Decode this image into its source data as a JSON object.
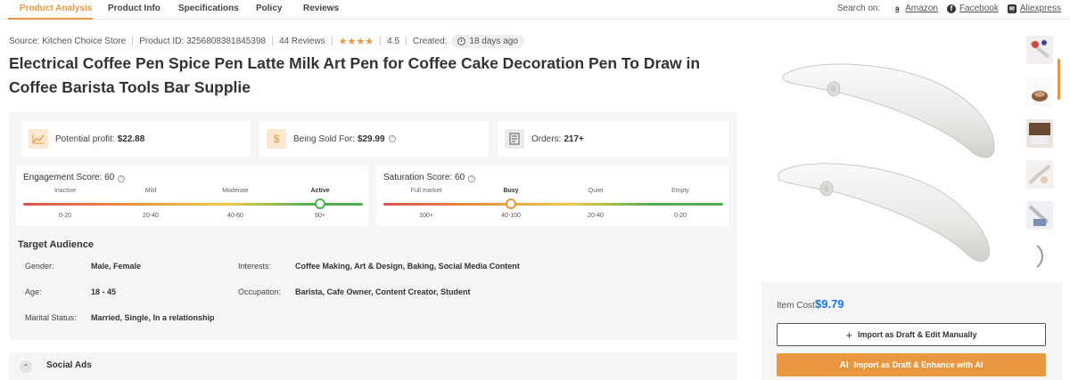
{
  "tabs": [
    {
      "label": "Product Analysis",
      "active": true
    },
    {
      "label": "Product Info",
      "active": false
    },
    {
      "label": "Specifications",
      "active": false
    },
    {
      "label": "Policy",
      "active": false
    },
    {
      "label": "Reviews",
      "active": false
    }
  ],
  "search_on": {
    "label": "Search on:",
    "links": [
      {
        "label": "Amazon",
        "icon": "amazon-icon"
      },
      {
        "label": "Facebook",
        "icon": "facebook-icon"
      },
      {
        "label": "Aliexpress",
        "icon": "mail-icon"
      }
    ]
  },
  "meta": {
    "source": "Source: Kitchen Choice Store",
    "product_id": "Product ID: 3256808381845398",
    "reviews": "44 Reviews",
    "stars": "★★★★",
    "rating": "4.5",
    "created_label": "Created:",
    "created_value": "18 days ago"
  },
  "title": "Electrical Coffee Pen Spice Pen Latte Milk Art Pen for Coffee Cake Decoration Pen To Draw in Coffee Barista Tools Bar Supplie",
  "stats": {
    "profit_label": "Potential profit:",
    "profit_value": "$22.88",
    "sold_label": "Being Sold For:",
    "sold_value": "$29.99",
    "orders_label": "Orders:",
    "orders_value": "217+"
  },
  "engagement": {
    "title": "Engagement Score: 60",
    "levels": [
      "Inactive",
      "Mild",
      "Moderate",
      "Active"
    ],
    "ranges": [
      "0-20",
      "20-40",
      "40-60",
      "60+"
    ],
    "active_index": 3
  },
  "saturation": {
    "title": "Saturation Score: 60",
    "levels": [
      "Full market",
      "Busy",
      "Quiet",
      "Empty"
    ],
    "ranges": [
      "100+",
      "40-100",
      "20-40",
      "0-20"
    ],
    "active_index": 1
  },
  "audience": {
    "title": "Target Audience",
    "gender_label": "Gender:",
    "gender_value": "Male, Female",
    "age_label": "Age:",
    "age_value": "18 - 45",
    "marital_label": "Marital Status:",
    "marital_value": "Married, Single, In a relationship",
    "interests_label": "Interests:",
    "interests_value": "Coffee Making, Art & Design, Baking, Social Media Content",
    "occupation_label": "Occupation:",
    "occupation_value": "Barista, Cafe Owner, Content Creator, Student"
  },
  "social": {
    "label": "Social Ads"
  },
  "cost": {
    "label": "Item Cost",
    "value": "$9.79",
    "import_manual": "Import as Draft & Edit Manually",
    "import_ai": "Import as Draft & Enhance with AI",
    "ai_icon_text": "AI"
  },
  "colors": {
    "accent": "#e8973f",
    "price": "#1a73e8"
  }
}
